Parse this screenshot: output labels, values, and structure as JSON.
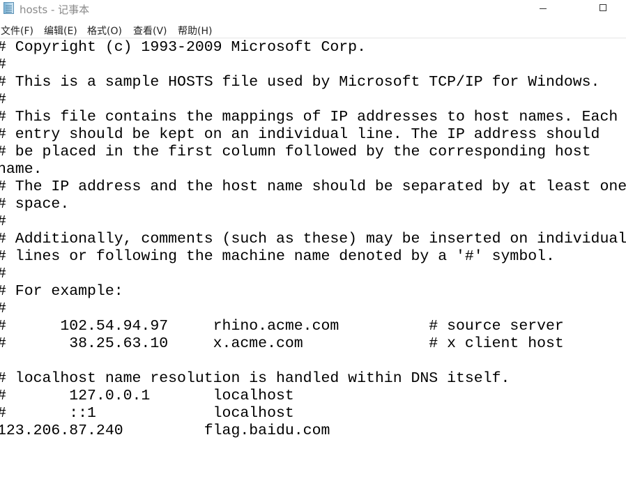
{
  "window": {
    "title": "hosts - 记事本",
    "app_icon": "notepad-icon"
  },
  "menu": [
    {
      "label": "文件(F)"
    },
    {
      "label": "编辑(E)"
    },
    {
      "label": "格式(O)"
    },
    {
      "label": "查看(V)"
    },
    {
      "label": "帮助(H)"
    }
  ],
  "editor": {
    "lines": [
      "# Copyright (c) 1993-2009 Microsoft Corp.",
      "#",
      "# This is a sample HOSTS file used by Microsoft TCP/IP for Windows.",
      "#",
      "# This file contains the mappings of IP addresses to host names. Each",
      "# entry should be kept on an individual line. The IP address should",
      "# be placed in the first column followed by the corresponding host",
      "name.",
      "# The IP address and the host name should be separated by at least one",
      "# space.",
      "#",
      "# Additionally, comments (such as these) may be inserted on individual",
      "# lines or following the machine name denoted by a '#' symbol.",
      "#",
      "# For example:",
      "#",
      "#      102.54.94.97     rhino.acme.com          # source server",
      "#       38.25.63.10     x.acme.com              # x client host",
      "",
      "# localhost name resolution is handled within DNS itself.",
      "#       127.0.0.1       localhost",
      "#       ::1             localhost",
      "123.206.87.240         flag.baidu.com"
    ]
  }
}
